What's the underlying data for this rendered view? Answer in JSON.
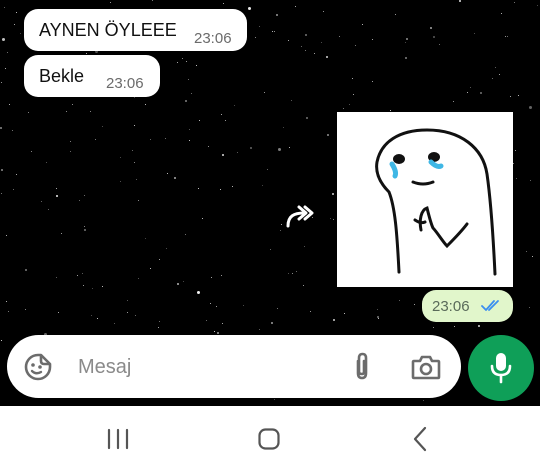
{
  "messages": [
    {
      "direction": "incoming",
      "text": "AYNEN ÖYLEEE",
      "time": "23:06"
    },
    {
      "direction": "incoming",
      "text": "Bekle",
      "time": "23:06"
    },
    {
      "direction": "outgoing",
      "type": "sticker",
      "time": "23:06",
      "status": "read"
    }
  ],
  "composer": {
    "placeholder": "Mesaj"
  },
  "icons": {
    "forward": "forward-icon",
    "emoji": "sticker-emoji-icon",
    "attach": "paperclip-icon",
    "camera": "camera-icon",
    "mic": "microphone-icon",
    "nav_recent": "recent-apps-icon",
    "nav_home": "home-icon",
    "nav_back": "back-icon"
  },
  "colors": {
    "outgoing_bubble": "#e1f6cb",
    "incoming_bubble": "#ffffff",
    "mic_button": "#0f9f58",
    "read_ticks": "#3b8ff0"
  }
}
